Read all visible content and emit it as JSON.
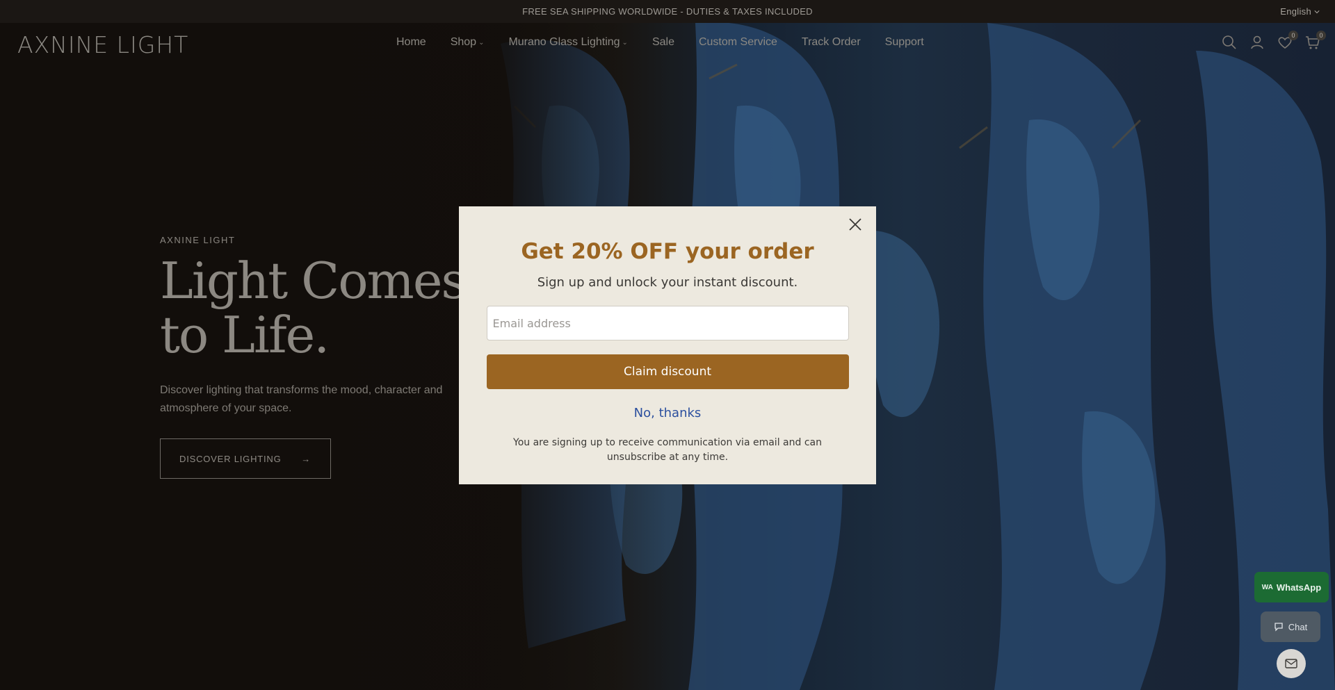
{
  "announcement": {
    "text": "FREE SEA SHIPPING WORLDWIDE - DUTIES & TAXES INCLUDED"
  },
  "language": {
    "label": "English"
  },
  "header": {
    "logo": "AXNINE LIGHT",
    "nav": [
      {
        "label": "Home"
      },
      {
        "label": "Shop"
      },
      {
        "label": "Murano Glass Lighting"
      },
      {
        "label": "Sale"
      },
      {
        "label": "Custom Service"
      },
      {
        "label": "Track Order"
      },
      {
        "label": "Support"
      }
    ],
    "wishlist_count": "0",
    "cart_count": "0"
  },
  "hero": {
    "eyebrow": "AXNINE LIGHT",
    "headline_line1": "Light Comes",
    "headline_line2": "to Life.",
    "subtext": "Discover lighting that transforms the mood, character and atmosphere of your space.",
    "cta": "DISCOVER LIGHTING"
  },
  "modal": {
    "title": "Get 20% OFF your order",
    "subtitle": "Sign up and unlock your instant discount.",
    "email_placeholder": "Email address",
    "claim_button": "Claim discount",
    "decline": "No, thanks",
    "disclaimer": "You are signing up to receive communication via email and can unsubscribe at any time."
  },
  "widgets": {
    "whatsapp_tag": "WA",
    "whatsapp": "WhatsApp",
    "chat": "Chat"
  },
  "colors": {
    "accent": "#9b6522",
    "link": "#2b4f9e",
    "modal_bg": "#ede9df",
    "whatsapp_green": "#1c6b33"
  }
}
